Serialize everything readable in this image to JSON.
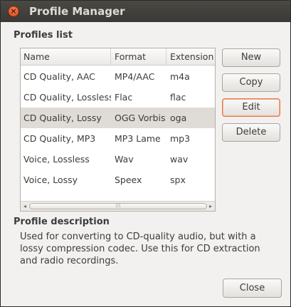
{
  "window": {
    "title": "Profile Manager",
    "close_icon": "close-icon",
    "close_glyph": "×"
  },
  "profiles_list": {
    "heading": "Profiles list",
    "columns": [
      "Name",
      "Format",
      "Extension"
    ],
    "rows": [
      {
        "name": "CD Quality, AAC",
        "format": "MP4/AAC",
        "extension": "m4a"
      },
      {
        "name": "CD Quality, Lossless",
        "format": "Flac",
        "extension": "flac"
      },
      {
        "name": "CD Quality, Lossy",
        "format": "OGG Vorbis",
        "extension": "oga"
      },
      {
        "name": "CD Quality, MP3",
        "format": "MP3 Lame",
        "extension": "mp3"
      },
      {
        "name": "Voice, Lossless",
        "format": "Wav",
        "extension": "wav"
      },
      {
        "name": "Voice, Lossy",
        "format": "Speex",
        "extension": "spx"
      }
    ],
    "selected_row": 2,
    "scrollbar": {
      "left_arrow": "◂",
      "right_arrow": "▸",
      "grip": "⁞⁞⁞"
    }
  },
  "buttons": {
    "new": "New",
    "copy": "Copy",
    "edit": "Edit",
    "delete": "Delete",
    "close": "Close"
  },
  "profile_description": {
    "heading": "Profile description",
    "text": "Used for converting to CD-quality audio, but with a lossy compression codec. Use this for CD extraction and radio recordings."
  }
}
